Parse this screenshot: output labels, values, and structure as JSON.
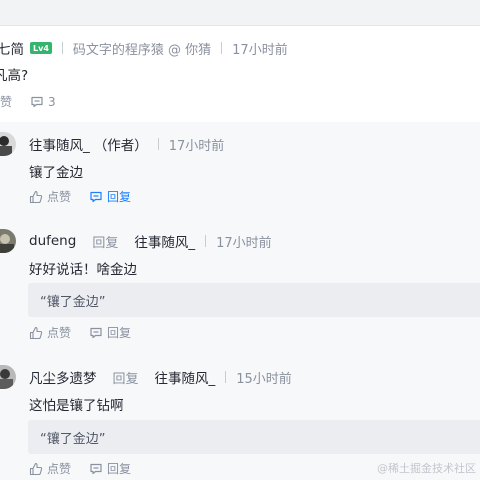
{
  "main_comment": {
    "username": "七简",
    "level_badge": "Lv4",
    "bio": "码文字的程序猿 @ 你猜",
    "time": "17小时前",
    "text": "凡高?",
    "like_label": "点赞",
    "comment_count": "3"
  },
  "replies": [
    {
      "username": "往事随风_",
      "author_tag": "（作者）",
      "time": "17小时前",
      "text": "镶了金边",
      "like_label": "点赞",
      "reply_label": "回复"
    },
    {
      "username": "dufeng",
      "reply_word": "回复",
      "reply_to": "往事随风_",
      "time": "17小时前",
      "text": "好好说话！啥金边",
      "quote": "“镶了金边”",
      "like_label": "点赞",
      "reply_label": "回复"
    },
    {
      "username": "凡尘多遗梦",
      "reply_word": "回复",
      "reply_to": "往事随风_",
      "time": "15小时前",
      "text": "这怕是镶了钻啊",
      "quote": "“镶了金边”",
      "like_label": "点赞",
      "reply_label": "回复"
    }
  ],
  "watermark": "@稀土掘金技术社区",
  "colors": {
    "accent": "#1e80ff",
    "level_badge": "#34b46f"
  }
}
